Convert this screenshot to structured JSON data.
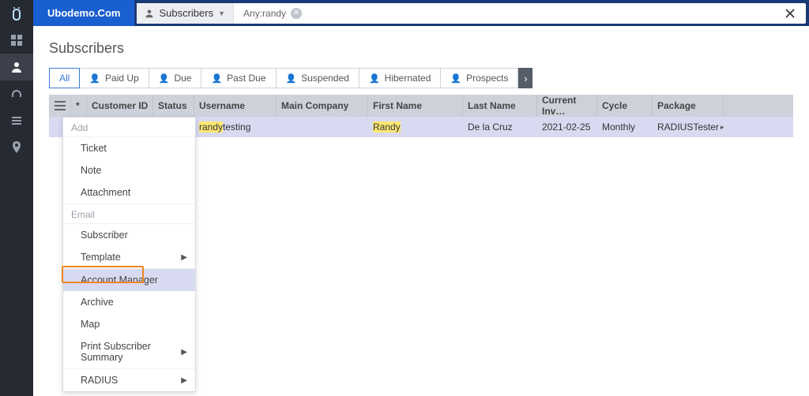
{
  "brand": "Ubodemo.Com",
  "breadcrumb": {
    "label": "Subscribers"
  },
  "chip": {
    "label": "Any:randy"
  },
  "page_title": "Subscribers",
  "filters": {
    "all": "All",
    "paidup": "Paid Up",
    "due": "Due",
    "pastdue": "Past Due",
    "suspended": "Suspended",
    "hibernated": "Hibernated",
    "prospects": "Prospects"
  },
  "columns": {
    "customer_id": "Customer ID",
    "status": "Status",
    "username": "Username",
    "main_company": "Main Company",
    "first_name": "First Name",
    "last_name": "Last Name",
    "current_inv": "Current Inv…",
    "cycle": "Cycle",
    "package": "Package"
  },
  "row": {
    "username_hl": "randy",
    "username_rest": "testing",
    "first_name_hl": "Randy",
    "last_name": "De la Cruz",
    "current_inv": "2021-02-25",
    "cycle": "Monthly",
    "package": "RADIUSTester"
  },
  "menu": {
    "add": "Add",
    "ticket": "Ticket",
    "note": "Note",
    "attachment": "Attachment",
    "email": "Email",
    "subscriber": "Subscriber",
    "template": "Template",
    "account_manager": "Account Manager",
    "archive": "Archive",
    "map": "Map",
    "print_summary": "Print Subscriber Summary",
    "radius": "RADIUS"
  }
}
